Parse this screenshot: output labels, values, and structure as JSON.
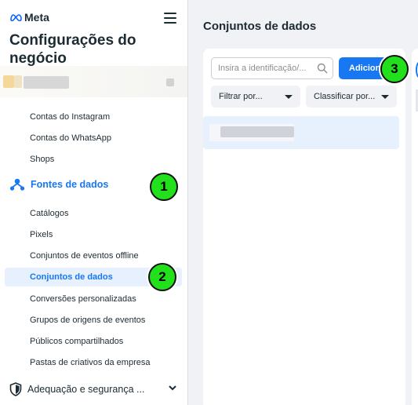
{
  "brand": {
    "logo_text": "Meta"
  },
  "sidebar": {
    "title": "Configurações do negócio",
    "items_top": [
      {
        "label": "Contas do Instagram"
      },
      {
        "label": "Contas do WhatsApp"
      },
      {
        "label": "Shops"
      }
    ],
    "section_label": "Fontes de dados",
    "items_data": [
      {
        "label": "Catálogos"
      },
      {
        "label": "Pixels"
      },
      {
        "label": "Conjuntos de eventos offline"
      },
      {
        "label": "Conjuntos de dados",
        "active": true
      },
      {
        "label": "Conversões personalizadas"
      },
      {
        "label": "Grupos de origens de eventos"
      },
      {
        "label": "Públicos compartilhados"
      },
      {
        "label": "Pastas de criativos da empresa"
      }
    ],
    "bottom_section_label": "Adequação e segurança ..."
  },
  "main": {
    "title": "Conjuntos de dados",
    "search": {
      "placeholder": "Insira a identificação/..."
    },
    "add_button": "Adicionar",
    "filter_label": "Filtrar por...",
    "sort_label": "Classificar por..."
  },
  "annotations": [
    "1",
    "2",
    "3"
  ],
  "colors": {
    "accent": "#1877f2",
    "active_bg": "#e7f0fd",
    "badge": "#22e01c"
  }
}
